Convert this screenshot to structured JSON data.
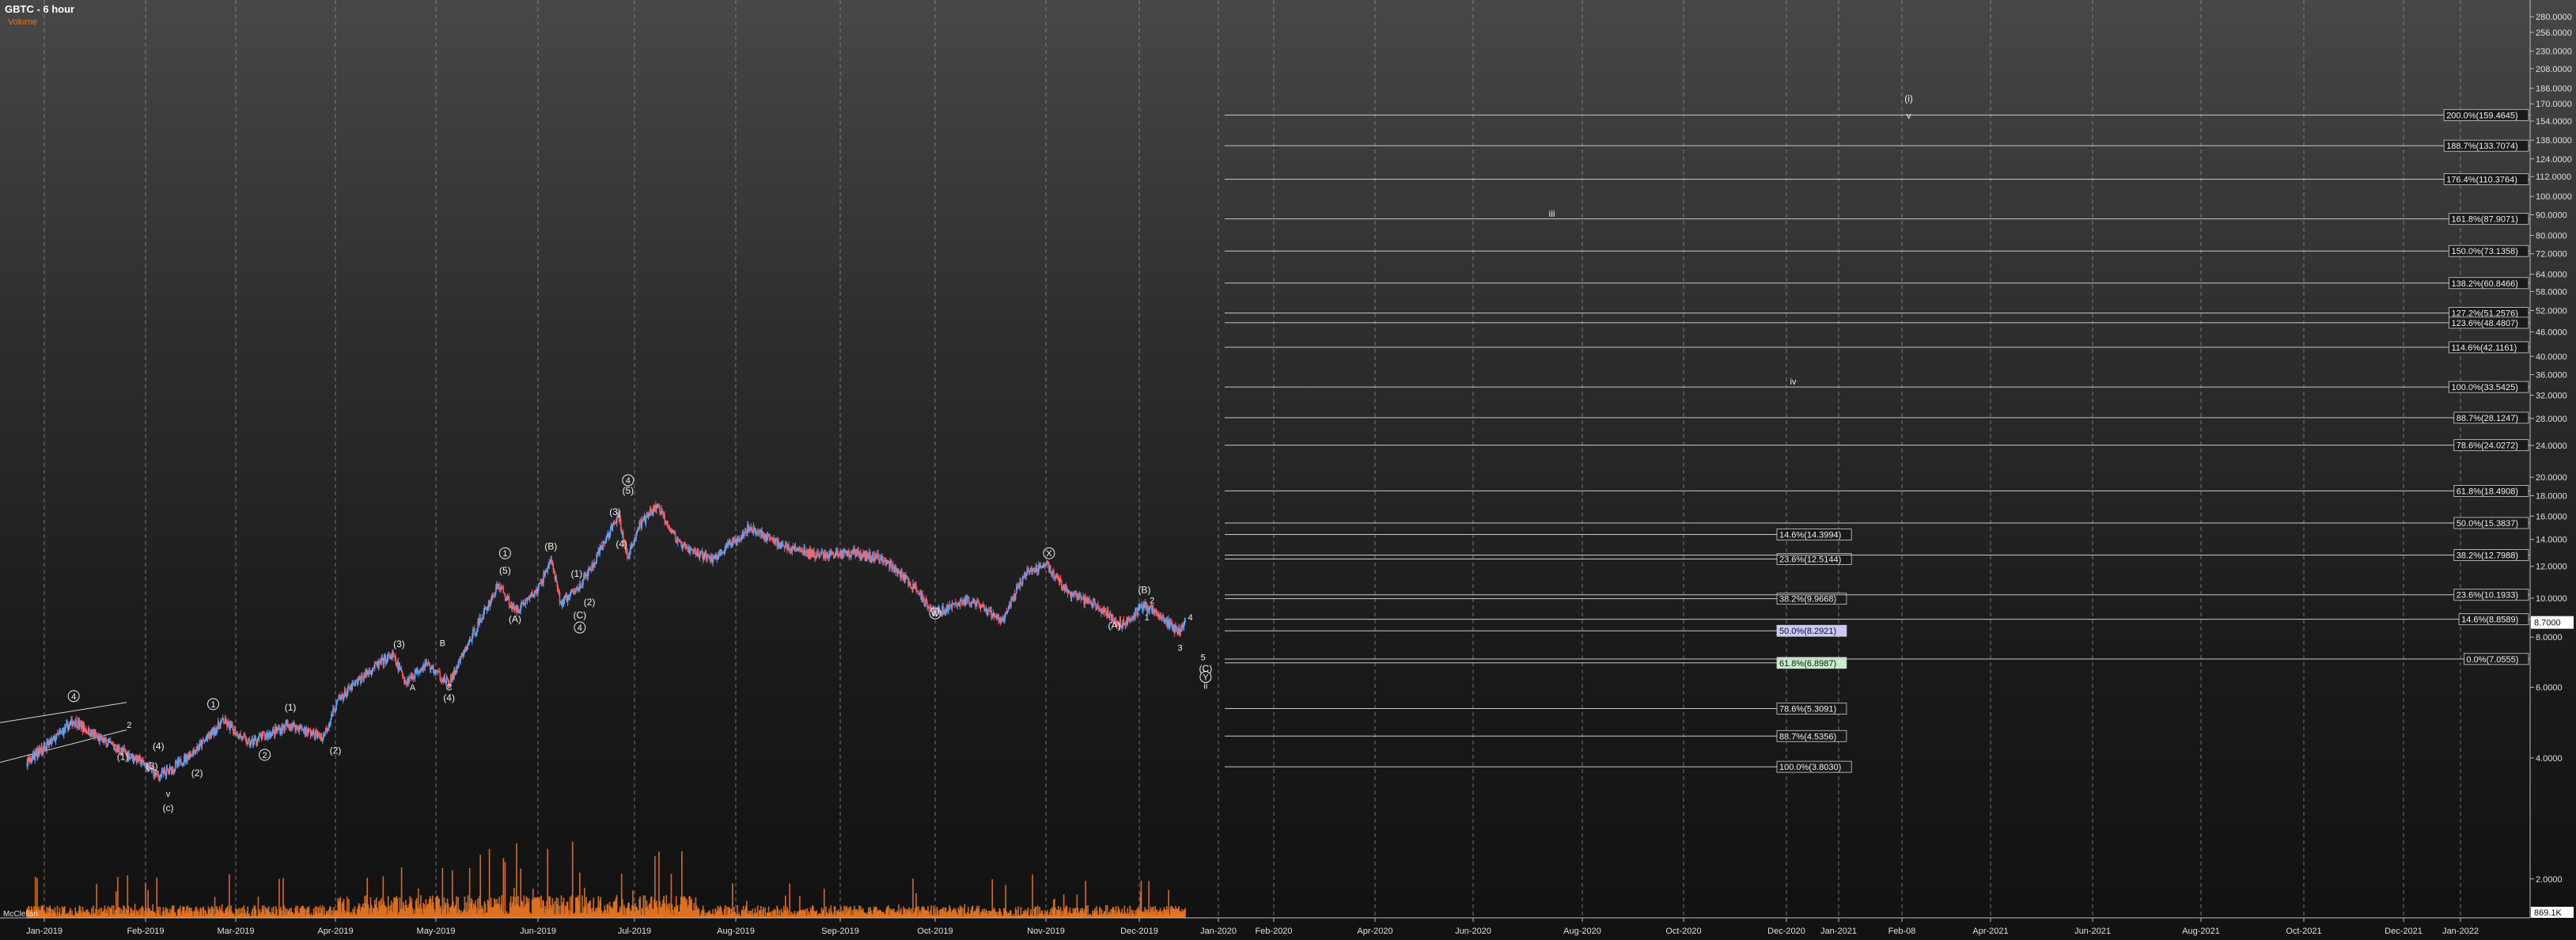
{
  "header": {
    "title": "GBTC - 6 hour",
    "subtitle": "Volume",
    "volume_label": "McClellan"
  },
  "chart_data": {
    "type": "candlestick",
    "title": "GBTC - 6 hour",
    "price_scale": "log",
    "ylim": [
      1.6,
      300
    ],
    "last_price": "8.7000",
    "last_volume": "869.1K",
    "y_ticks": [
      "280.0000",
      "256.0000",
      "230.0000",
      "208.0000",
      "186.0000",
      "170.0000",
      "154.0000",
      "138.0000",
      "124.0000",
      "112.0000",
      "100.0000",
      "90.0000",
      "80.0000",
      "72.0000",
      "64.0000",
      "58.0000",
      "52.0000",
      "46.0000",
      "40.0000",
      "36.0000",
      "32.0000",
      "28.0000",
      "24.0000",
      "20.0000",
      "18.0000",
      "16.0000",
      "14.0000",
      "12.0000",
      "10.0000",
      "8.0000",
      "6.0000",
      "4.0000",
      "2.0000"
    ],
    "x_ticks": [
      "Jan-2019",
      "Feb-2019",
      "Mar-2019",
      "Apr-2019",
      "May-2019",
      "Jun-2019",
      "Jul-2019",
      "Aug-2019",
      "Sep-2019",
      "Oct-2019",
      "Nov-2019",
      "Dec-2019",
      "Jan-2020",
      "Feb-2020",
      "Apr-2020",
      "Jun-2020",
      "Aug-2020",
      "Oct-2020",
      "Dec-2020",
      "Jan-2021",
      "Feb-08",
      "Apr-2021",
      "Jun-2021",
      "Aug-2021",
      "Oct-2021",
      "Dec-2021",
      "Jan-2022"
    ],
    "price_path": [
      [
        "2018-12-20",
        3.9
      ],
      [
        "2019-01-02",
        4.3
      ],
      [
        "2019-01-10",
        4.95
      ],
      [
        "2019-01-18",
        4.45
      ],
      [
        "2019-01-25",
        4.15
      ],
      [
        "2019-01-30",
        3.95
      ],
      [
        "2019-02-05",
        3.6
      ],
      [
        "2019-02-10",
        3.8
      ],
      [
        "2019-02-18",
        4.3
      ],
      [
        "2019-02-25",
        4.95
      ],
      [
        "2019-03-05",
        4.35
      ],
      [
        "2019-03-10",
        4.55
      ],
      [
        "2019-03-18",
        4.85
      ],
      [
        "2019-03-28",
        4.5
      ],
      [
        "2019-04-02",
        5.6
      ],
      [
        "2019-04-12",
        6.7
      ],
      [
        "2019-04-18",
        7.2
      ],
      [
        "2019-04-22",
        6.2
      ],
      [
        "2019-04-28",
        6.9
      ],
      [
        "2019-05-05",
        6.1
      ],
      [
        "2019-05-08",
        6.9
      ],
      [
        "2019-05-15",
        9.0
      ],
      [
        "2019-05-20",
        10.8
      ],
      [
        "2019-05-25",
        9.3
      ],
      [
        "2019-06-01",
        10.5
      ],
      [
        "2019-06-05",
        12.5
      ],
      [
        "2019-06-08",
        9.7
      ],
      [
        "2019-06-13",
        10.5
      ],
      [
        "2019-06-18",
        12.0
      ],
      [
        "2019-06-22",
        14.0
      ],
      [
        "2019-06-26",
        16.0
      ],
      [
        "2019-06-29",
        12.5
      ],
      [
        "2019-07-02",
        15.0
      ],
      [
        "2019-07-08",
        17.0
      ],
      [
        "2019-07-15",
        13.5
      ],
      [
        "2019-07-25",
        12.5
      ],
      [
        "2019-08-05",
        15.0
      ],
      [
        "2019-08-15",
        13.5
      ],
      [
        "2019-08-25",
        12.8
      ],
      [
        "2019-09-05",
        13.0
      ],
      [
        "2019-09-15",
        12.5
      ],
      [
        "2019-09-25",
        10.5
      ],
      [
        "2019-10-01",
        9.2
      ],
      [
        "2019-10-10",
        9.9
      ],
      [
        "2019-10-20",
        8.8
      ],
      [
        "2019-10-26",
        11.5
      ],
      [
        "2019-11-01",
        12.2
      ],
      [
        "2019-11-08",
        10.3
      ],
      [
        "2019-11-18",
        9.5
      ],
      [
        "2019-11-25",
        8.6
      ],
      [
        "2019-12-03",
        9.6
      ],
      [
        "2019-12-10",
        8.9
      ],
      [
        "2019-12-17",
        8.2
      ],
      [
        "2019-12-19",
        8.7
      ]
    ],
    "fib_levels_lower": [
      {
        "label": "14.6%(14.3994)",
        "value": 14.3994
      },
      {
        "label": "23.6%(12.5144)",
        "value": 12.5144
      },
      {
        "label": "38.2%(9.9668)",
        "value": 9.9668
      },
      {
        "label": "50.0%(8.2921)",
        "value": 8.2921,
        "highlight": "#c8c8ff"
      },
      {
        "label": "61.8%(6.8987)",
        "value": 6.8987,
        "highlight": "#c8f0c8"
      },
      {
        "label": "78.6%(5.3091)",
        "value": 5.3091
      },
      {
        "label": "88.7%(4.5356)",
        "value": 4.5356
      },
      {
        "label": "100.0%(3.8030)",
        "value": 3.803
      }
    ],
    "fib_levels_upper": [
      {
        "label": "200.0%(159.4645)",
        "value": 159.4645
      },
      {
        "label": "188.7%(133.7074)",
        "value": 133.7074
      },
      {
        "label": "176.4%(110.3764)",
        "value": 110.3764
      },
      {
        "label": "161.8%(87.9071)",
        "value": 87.9071
      },
      {
        "label": "150.0%(73.1358)",
        "value": 73.1358
      },
      {
        "label": "138.2%(60.8466)",
        "value": 60.8466
      },
      {
        "label": "127.2%(51.2576)",
        "value": 51.2576
      },
      {
        "label": "123.6%(48.4807)",
        "value": 48.4807
      },
      {
        "label": "114.6%(42.1161)",
        "value": 42.1161
      },
      {
        "label": "100.0%(33.5425)",
        "value": 33.5425
      },
      {
        "label": "88.7%(28.1247)",
        "value": 28.1247
      },
      {
        "label": "78.6%(24.0272)",
        "value": 24.0272
      },
      {
        "label": "61.8%(18.4908)",
        "value": 18.4908
      },
      {
        "label": "50.0%(15.3837)",
        "value": 15.3837
      },
      {
        "label": "38.2%(12.7988)",
        "value": 12.7988
      },
      {
        "label": "23.6%(10.1933)",
        "value": 10.1933
      },
      {
        "label": "14.6%(8.8589)",
        "value": 8.8589
      },
      {
        "label": "0.0%(7.0555)",
        "value": 7.0555
      }
    ],
    "annotations": [
      {
        "text": "4",
        "date": "2019-01-10",
        "price": 5.6,
        "circle": true
      },
      {
        "text": "2",
        "date": "2019-01-27",
        "price": 4.75
      },
      {
        "text": "(1)",
        "date": "2019-01-25",
        "price": 3.95
      },
      {
        "text": "(3)",
        "date": "2019-02-03",
        "price": 3.75
      },
      {
        "text": "(4)",
        "date": "2019-02-05",
        "price": 4.2
      },
      {
        "text": "(2)",
        "date": "2019-02-17",
        "price": 3.6
      },
      {
        "text": "v",
        "date": "2019-02-08",
        "price": 3.2
      },
      {
        "text": "(c)",
        "date": "2019-02-08",
        "price": 2.95
      },
      {
        "text": "1",
        "date": "2019-02-22",
        "price": 5.35,
        "circle": true
      },
      {
        "text": "2",
        "date": "2019-03-10",
        "price": 4.0,
        "circle": true
      },
      {
        "text": "(1)",
        "date": "2019-03-18",
        "price": 5.25
      },
      {
        "text": "(2)",
        "date": "2019-04-01",
        "price": 4.1
      },
      {
        "text": "(3)",
        "date": "2019-04-20",
        "price": 7.55
      },
      {
        "text": "B",
        "date": "2019-05-03",
        "price": 7.6
      },
      {
        "text": "A",
        "date": "2019-04-24",
        "price": 5.9
      },
      {
        "text": "C",
        "date": "2019-05-05",
        "price": 5.9
      },
      {
        "text": "(4)",
        "date": "2019-05-05",
        "price": 5.55
      },
      {
        "text": "1",
        "date": "2019-05-22",
        "price": 12.7,
        "circle": true
      },
      {
        "text": "(5)",
        "date": "2019-05-22",
        "price": 11.5
      },
      {
        "text": "(A)",
        "date": "2019-05-25",
        "price": 8.7
      },
      {
        "text": "(B)",
        "date": "2019-06-05",
        "price": 13.2
      },
      {
        "text": "(1)",
        "date": "2019-06-13",
        "price": 11.3
      },
      {
        "text": "(2)",
        "date": "2019-06-17",
        "price": 9.6
      },
      {
        "text": "(C)",
        "date": "2019-06-14",
        "price": 8.9
      },
      {
        "text": "4",
        "date": "2019-06-14",
        "price": 8.3,
        "circle": true
      },
      {
        "text": "(3)",
        "date": "2019-06-25",
        "price": 16.1
      },
      {
        "text": "(4)",
        "date": "2019-06-27",
        "price": 13.4
      },
      {
        "text": "4",
        "date": "2019-06-29",
        "price": 19.3,
        "circle": true
      },
      {
        "text": "(5)",
        "date": "2019-06-29",
        "price": 18.2
      },
      {
        "text": "W",
        "date": "2019-10-01",
        "price": 9.0,
        "circle": true
      },
      {
        "text": "X",
        "date": "2019-11-02",
        "price": 12.7,
        "circle": true
      },
      {
        "text": "(A)",
        "date": "2019-11-23",
        "price": 8.4
      },
      {
        "text": "(B)",
        "date": "2019-12-03",
        "price": 10.3
      },
      {
        "text": "2",
        "date": "2019-12-06",
        "price": 9.7
      },
      {
        "text": "1",
        "date": "2019-12-04",
        "price": 8.8
      },
      {
        "text": "4",
        "date": "2019-12-21",
        "price": 8.8
      },
      {
        "text": "3",
        "date": "2019-12-17",
        "price": 7.4
      },
      {
        "text": "5",
        "date": "2019-12-26",
        "price": 7.0
      },
      {
        "text": "(C)",
        "date": "2019-12-27",
        "price": 6.55
      },
      {
        "text": "Y",
        "date": "2019-12-27",
        "price": 6.25,
        "circle": true
      },
      {
        "text": "ii",
        "date": "2019-12-27",
        "price": 5.95
      },
      {
        "text": "iii",
        "date": "2020-07-15",
        "price": 89
      },
      {
        "text": "iv",
        "date": "2020-12-05",
        "price": 34
      },
      {
        "text": "(i)",
        "date": "2021-02-12",
        "price": 172
      },
      {
        "text": "v",
        "date": "2021-02-12",
        "price": 156
      }
    ]
  },
  "colors": {
    "up_candle": "#5aa9ff",
    "down_candle": "#ff5a5a",
    "volume": "#e87722",
    "grid": "#9a9a9a",
    "fib_line": "#c8c8c8",
    "label_bg": "#1a1a1a",
    "last_price_bg": "#ffffff"
  }
}
